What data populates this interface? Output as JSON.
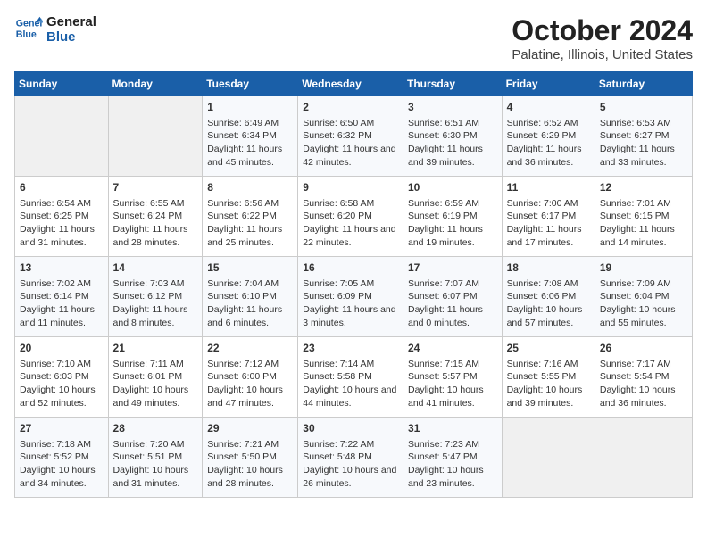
{
  "header": {
    "logo_line1": "General",
    "logo_line2": "Blue",
    "title": "October 2024",
    "subtitle": "Palatine, Illinois, United States"
  },
  "weekdays": [
    "Sunday",
    "Monday",
    "Tuesday",
    "Wednesday",
    "Thursday",
    "Friday",
    "Saturday"
  ],
  "weeks": [
    [
      {
        "day": "",
        "empty": true
      },
      {
        "day": "",
        "empty": true
      },
      {
        "day": "1",
        "sunrise": "6:49 AM",
        "sunset": "6:34 PM",
        "daylight": "11 hours and 45 minutes."
      },
      {
        "day": "2",
        "sunrise": "6:50 AM",
        "sunset": "6:32 PM",
        "daylight": "11 hours and 42 minutes."
      },
      {
        "day": "3",
        "sunrise": "6:51 AM",
        "sunset": "6:30 PM",
        "daylight": "11 hours and 39 minutes."
      },
      {
        "day": "4",
        "sunrise": "6:52 AM",
        "sunset": "6:29 PM",
        "daylight": "11 hours and 36 minutes."
      },
      {
        "day": "5",
        "sunrise": "6:53 AM",
        "sunset": "6:27 PM",
        "daylight": "11 hours and 33 minutes."
      }
    ],
    [
      {
        "day": "6",
        "sunrise": "6:54 AM",
        "sunset": "6:25 PM",
        "daylight": "11 hours and 31 minutes."
      },
      {
        "day": "7",
        "sunrise": "6:55 AM",
        "sunset": "6:24 PM",
        "daylight": "11 hours and 28 minutes."
      },
      {
        "day": "8",
        "sunrise": "6:56 AM",
        "sunset": "6:22 PM",
        "daylight": "11 hours and 25 minutes."
      },
      {
        "day": "9",
        "sunrise": "6:58 AM",
        "sunset": "6:20 PM",
        "daylight": "11 hours and 22 minutes."
      },
      {
        "day": "10",
        "sunrise": "6:59 AM",
        "sunset": "6:19 PM",
        "daylight": "11 hours and 19 minutes."
      },
      {
        "day": "11",
        "sunrise": "7:00 AM",
        "sunset": "6:17 PM",
        "daylight": "11 hours and 17 minutes."
      },
      {
        "day": "12",
        "sunrise": "7:01 AM",
        "sunset": "6:15 PM",
        "daylight": "11 hours and 14 minutes."
      }
    ],
    [
      {
        "day": "13",
        "sunrise": "7:02 AM",
        "sunset": "6:14 PM",
        "daylight": "11 hours and 11 minutes."
      },
      {
        "day": "14",
        "sunrise": "7:03 AM",
        "sunset": "6:12 PM",
        "daylight": "11 hours and 8 minutes."
      },
      {
        "day": "15",
        "sunrise": "7:04 AM",
        "sunset": "6:10 PM",
        "daylight": "11 hours and 6 minutes."
      },
      {
        "day": "16",
        "sunrise": "7:05 AM",
        "sunset": "6:09 PM",
        "daylight": "11 hours and 3 minutes."
      },
      {
        "day": "17",
        "sunrise": "7:07 AM",
        "sunset": "6:07 PM",
        "daylight": "11 hours and 0 minutes."
      },
      {
        "day": "18",
        "sunrise": "7:08 AM",
        "sunset": "6:06 PM",
        "daylight": "10 hours and 57 minutes."
      },
      {
        "day": "19",
        "sunrise": "7:09 AM",
        "sunset": "6:04 PM",
        "daylight": "10 hours and 55 minutes."
      }
    ],
    [
      {
        "day": "20",
        "sunrise": "7:10 AM",
        "sunset": "6:03 PM",
        "daylight": "10 hours and 52 minutes."
      },
      {
        "day": "21",
        "sunrise": "7:11 AM",
        "sunset": "6:01 PM",
        "daylight": "10 hours and 49 minutes."
      },
      {
        "day": "22",
        "sunrise": "7:12 AM",
        "sunset": "6:00 PM",
        "daylight": "10 hours and 47 minutes."
      },
      {
        "day": "23",
        "sunrise": "7:14 AM",
        "sunset": "5:58 PM",
        "daylight": "10 hours and 44 minutes."
      },
      {
        "day": "24",
        "sunrise": "7:15 AM",
        "sunset": "5:57 PM",
        "daylight": "10 hours and 41 minutes."
      },
      {
        "day": "25",
        "sunrise": "7:16 AM",
        "sunset": "5:55 PM",
        "daylight": "10 hours and 39 minutes."
      },
      {
        "day": "26",
        "sunrise": "7:17 AM",
        "sunset": "5:54 PM",
        "daylight": "10 hours and 36 minutes."
      }
    ],
    [
      {
        "day": "27",
        "sunrise": "7:18 AM",
        "sunset": "5:52 PM",
        "daylight": "10 hours and 34 minutes."
      },
      {
        "day": "28",
        "sunrise": "7:20 AM",
        "sunset": "5:51 PM",
        "daylight": "10 hours and 31 minutes."
      },
      {
        "day": "29",
        "sunrise": "7:21 AM",
        "sunset": "5:50 PM",
        "daylight": "10 hours and 28 minutes."
      },
      {
        "day": "30",
        "sunrise": "7:22 AM",
        "sunset": "5:48 PM",
        "daylight": "10 hours and 26 minutes."
      },
      {
        "day": "31",
        "sunrise": "7:23 AM",
        "sunset": "5:47 PM",
        "daylight": "10 hours and 23 minutes."
      },
      {
        "day": "",
        "empty": true
      },
      {
        "day": "",
        "empty": true
      }
    ]
  ]
}
